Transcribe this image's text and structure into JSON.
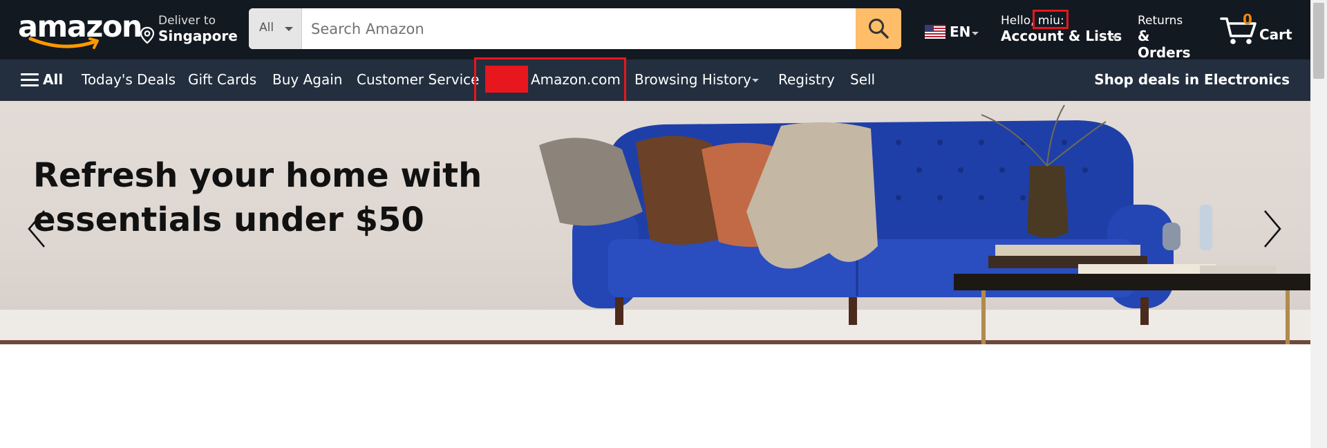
{
  "header": {
    "logo_text": "amazon",
    "deliver": {
      "line1": "Deliver to",
      "line2": "Singapore"
    },
    "search": {
      "category": "All",
      "placeholder": "Search Amazon",
      "value": ""
    },
    "language": {
      "code": "EN"
    },
    "account": {
      "greeting": "Hello, ",
      "username": "miu:",
      "label": "Account & Lists"
    },
    "returns": {
      "line1": "Returns",
      "line2": "& Orders"
    },
    "cart": {
      "count": "0",
      "label": "Cart"
    }
  },
  "subnav": {
    "all_label": "All",
    "items": [
      "Today's Deals",
      "Gift Cards",
      "Buy Again",
      "Customer Service",
      "Amazon.com",
      "Browsing History",
      "Registry",
      "Sell"
    ],
    "promo": "Shop deals in Electronics"
  },
  "hero": {
    "title_line1": "Refresh your home with",
    "title_line2": "essentials under $50"
  },
  "colors": {
    "nav_dark": "#131921",
    "subnav": "#232f3e",
    "search_button": "#febd69",
    "cart_count": "#f08804",
    "annotation_red": "#e8161d",
    "sofa_blue": "#1f3fa8"
  }
}
